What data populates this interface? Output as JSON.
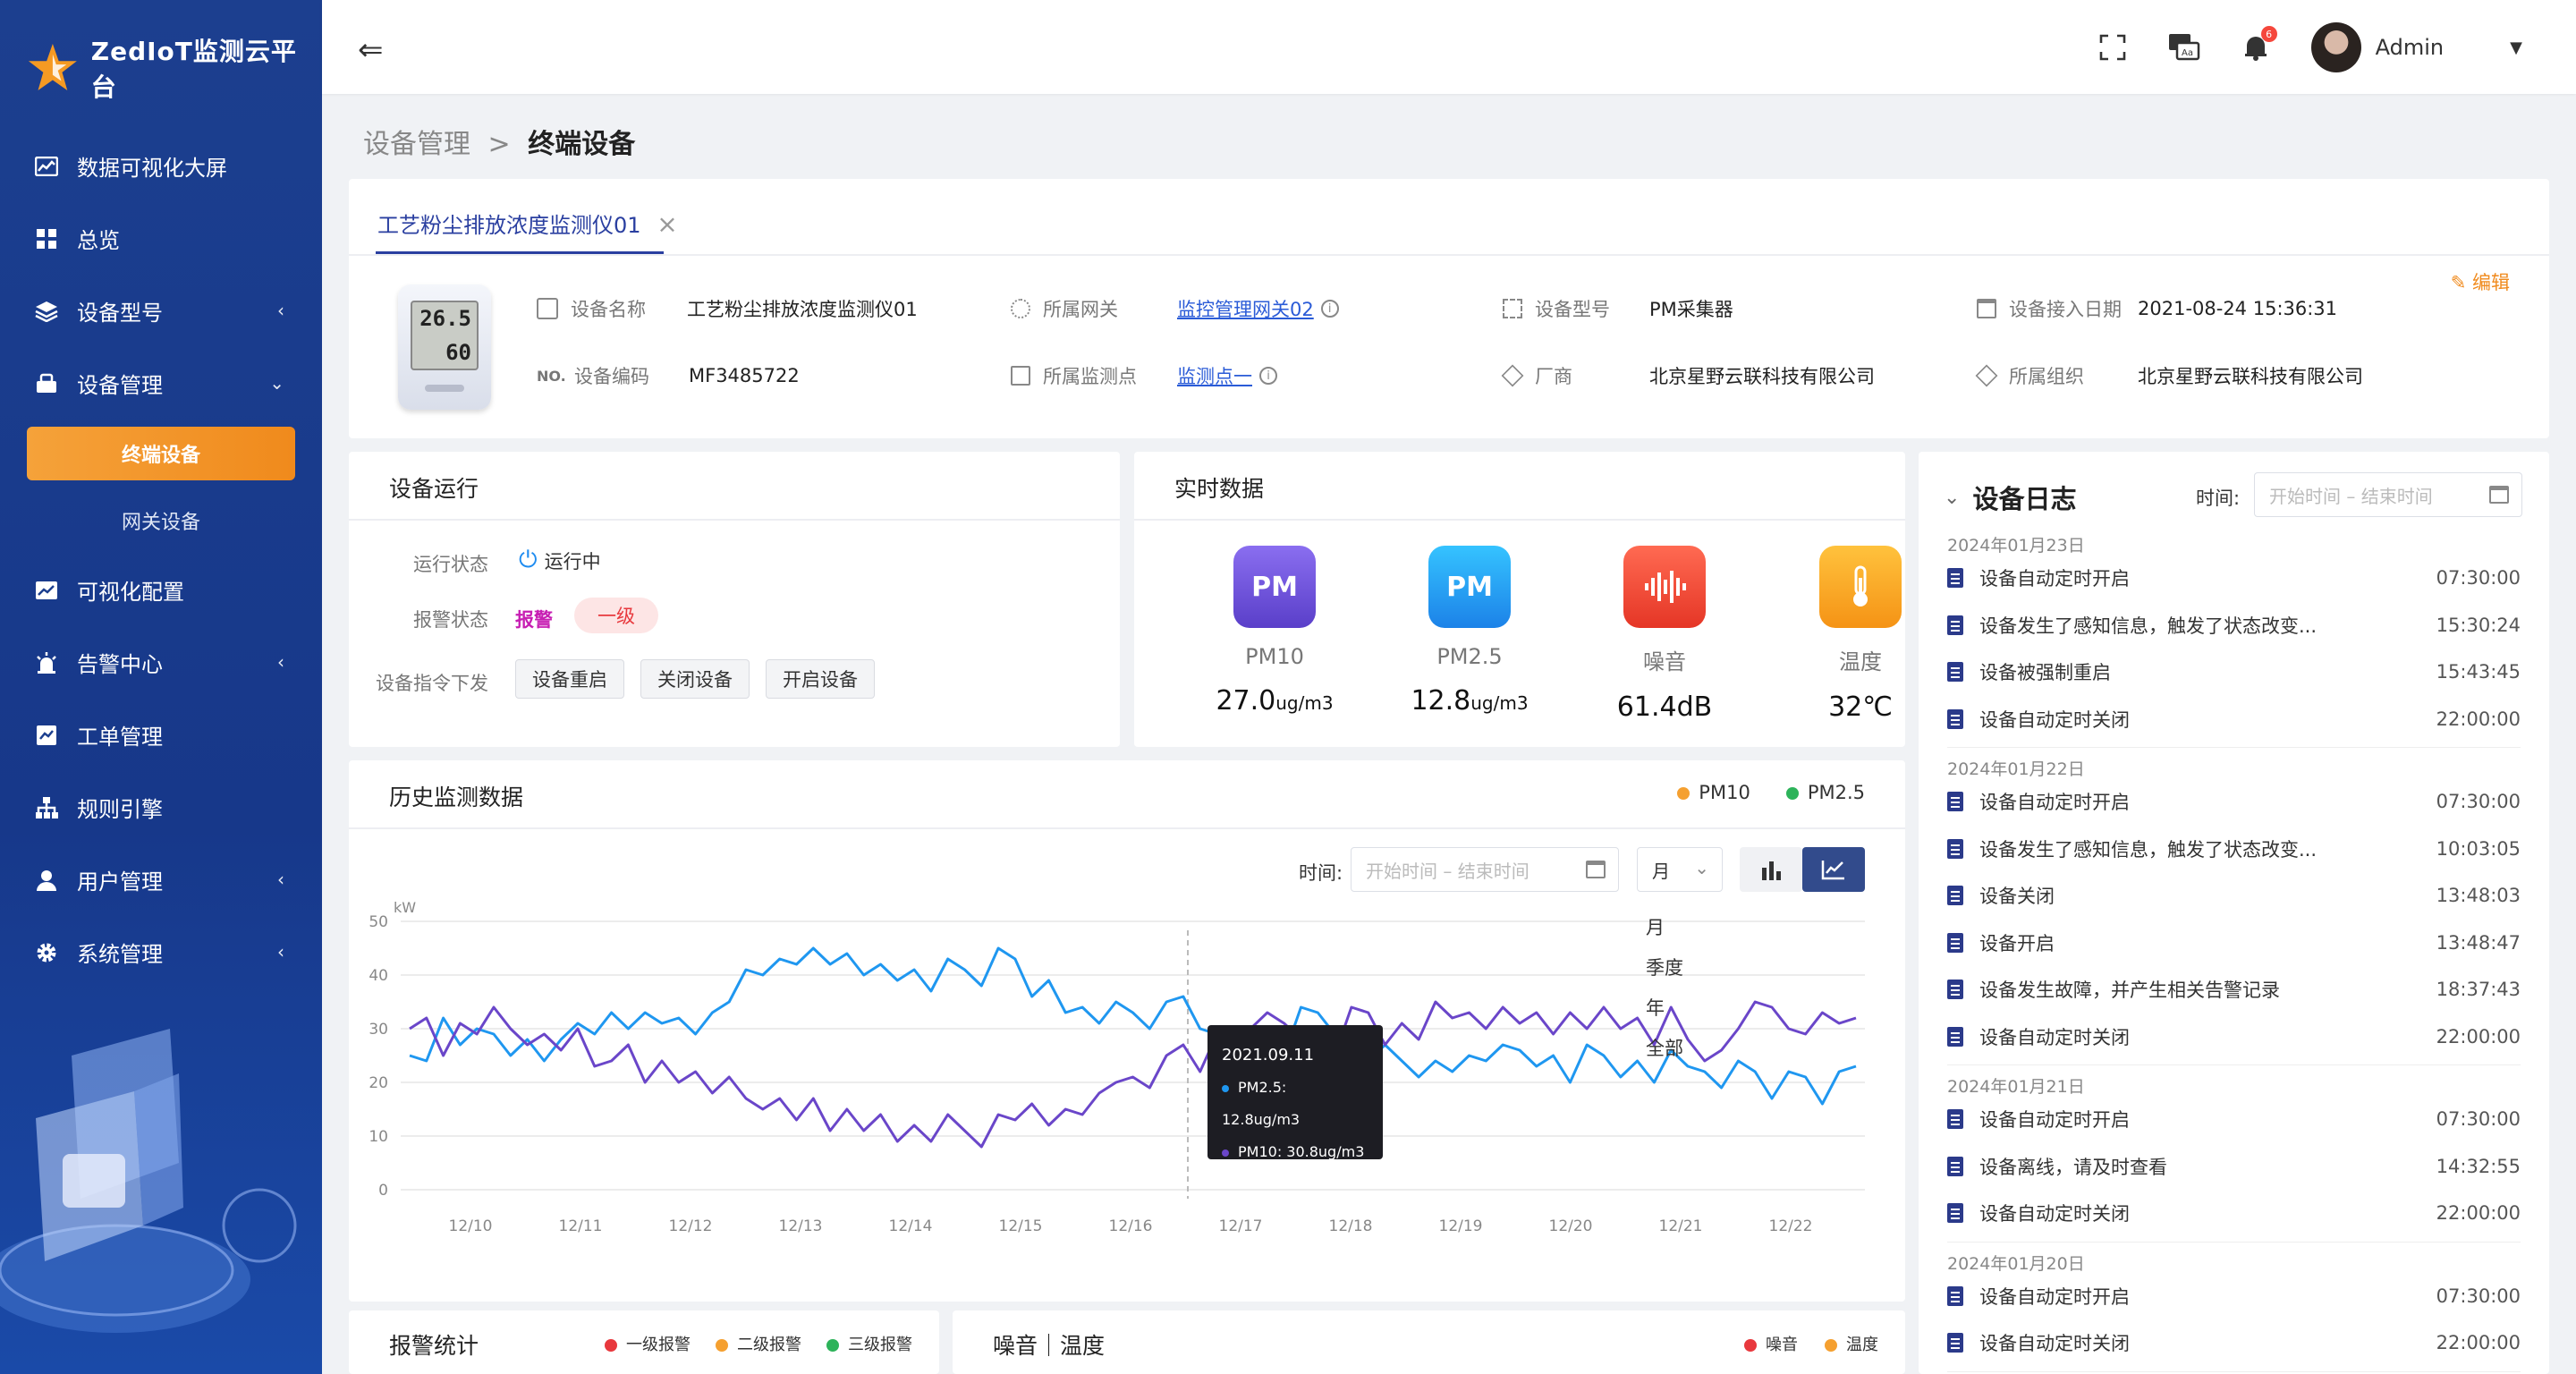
{
  "app": {
    "title": "ZedIoT监测云平台"
  },
  "sidebar": {
    "items": [
      {
        "label": "数据可视化大屏",
        "icon": "chart-area-icon"
      },
      {
        "label": "总览",
        "icon": "grid-icon"
      },
      {
        "label": "设备型号",
        "icon": "layers-icon"
      },
      {
        "label": "设备管理",
        "icon": "device-icon"
      },
      {
        "label": "终端设备",
        "sub": true,
        "active": true
      },
      {
        "label": "网关设备",
        "sub": true
      },
      {
        "label": "可视化配置",
        "icon": "chart-line-icon"
      },
      {
        "label": "告警中心",
        "icon": "alarm-icon"
      },
      {
        "label": "工单管理",
        "icon": "workorder-icon"
      },
      {
        "label": "规则引擎",
        "icon": "rules-icon"
      },
      {
        "label": "用户管理",
        "icon": "user-icon"
      },
      {
        "label": "系统管理",
        "icon": "gear-icon"
      }
    ]
  },
  "topbar": {
    "user": "Admin",
    "notify_count": "6"
  },
  "breadcrumb": {
    "parent": "设备管理",
    "sep": ">",
    "current": "终端设备"
  },
  "tab": {
    "label": "工艺粉尘排放浓度监测仪01",
    "close": "×"
  },
  "device": {
    "edit": "编辑",
    "display_a": "26.5",
    "display_b": "60",
    "name_label": "设备名称",
    "name": "工艺粉尘排放浓度监测仪01",
    "code_prefix": "NO.",
    "code_label": "设备编码",
    "code": "MF3485722",
    "gateway_label": "所属网关",
    "gateway": "监控管理网关02",
    "point_label": "所属监测点",
    "point": "监测点一",
    "model_label": "设备型号",
    "model": "PM采集器",
    "vendor_label": "厂商",
    "vendor": "北京星野云联科技有限公司",
    "date_label": "设备接入日期",
    "date": "2021-08-24 15:36:31",
    "org_label": "所属组织",
    "org": "北京星野云联科技有限公司"
  },
  "run": {
    "title": "设备运行",
    "status_label": "运行状态",
    "status": "运行中",
    "alarm_label": "报警状态",
    "alarm": "报警",
    "alarm_level": "一级",
    "cmd_label": "设备指令下发",
    "buttons": [
      "设备重启",
      "关闭设备",
      "开启设备"
    ]
  },
  "realtime": {
    "title": "实时数据",
    "items": [
      {
        "icon_text": "PM",
        "name": "PM10",
        "value": "27.0",
        "unit": "ug/m3",
        "color": "#6a4fd8"
      },
      {
        "icon_text": "PM",
        "name": "PM2.5",
        "value": "12.8",
        "unit": "ug/m3",
        "color": "#2a9bf0"
      },
      {
        "icon_text": "",
        "name": "噪音",
        "value": "61.4dB",
        "unit": "",
        "color": "#f0493a"
      },
      {
        "icon_text": "",
        "name": "温度",
        "value": "32℃",
        "unit": "",
        "color": "#f5a623"
      }
    ]
  },
  "history": {
    "title": "历史监测数据",
    "legend": [
      {
        "name": "PM10",
        "color": "#f5a030"
      },
      {
        "name": "PM2.5",
        "color": "#2db35a"
      }
    ],
    "time_label": "时间:",
    "date_placeholder": "开始时间 – 结束时间",
    "period": "月",
    "dropdown_options": [
      "月",
      "季度",
      "年",
      "全部"
    ],
    "tooltip": {
      "date": "2021.09.11",
      "pm25": "PM2.5: 12.8ug/m3",
      "pm10": "PM10: 30.8ug/m3"
    }
  },
  "log": {
    "title": "设备日志",
    "time_label": "时间:",
    "date_placeholder": "开始时间 – 结束时间",
    "groups": [
      {
        "date": "2024年01月23日",
        "rows": [
          {
            "text": "设备自动定时开启",
            "time": "07:30:00"
          },
          {
            "text": "设备发生了感知信息，触发了状态改变...",
            "time": "15:30:24"
          },
          {
            "text": "设备被强制重启",
            "time": "15:43:45"
          },
          {
            "text": "设备自动定时关闭",
            "time": "22:00:00"
          }
        ]
      },
      {
        "date": "2024年01月22日",
        "rows": [
          {
            "text": "设备自动定时开启",
            "time": "07:30:00"
          },
          {
            "text": "设备发生了感知信息，触发了状态改变...",
            "time": "10:03:05"
          },
          {
            "text": "设备关闭",
            "time": "13:48:03"
          },
          {
            "text": "设备开启",
            "time": "13:48:47"
          },
          {
            "text": "设备发生故障，并产生相关告警记录",
            "time": "18:37:43"
          },
          {
            "text": "设备自动定时关闭",
            "time": "22:00:00"
          }
        ]
      },
      {
        "date": "2024年01月21日",
        "rows": [
          {
            "text": "设备自动定时开启",
            "time": "07:30:00"
          },
          {
            "text": "设备离线，请及时查看",
            "time": "14:32:55"
          },
          {
            "text": "设备自动定时关闭",
            "time": "22:00:00"
          }
        ]
      },
      {
        "date": "2024年01月20日",
        "rows": [
          {
            "text": "设备自动定时开启",
            "time": "07:30:00"
          },
          {
            "text": "设备自动定时关闭",
            "time": "22:00:00"
          }
        ]
      }
    ]
  },
  "alarm_stats": {
    "title": "报警统计",
    "legend": [
      {
        "name": "一级报警",
        "color": "#e8383d"
      },
      {
        "name": "二级报警",
        "color": "#f5a030"
      },
      {
        "name": "三级报警",
        "color": "#2db35a"
      }
    ]
  },
  "noise_temp": {
    "title": "噪音｜温度",
    "legend": [
      {
        "name": "噪音",
        "color": "#e8383d"
      },
      {
        "name": "温度",
        "color": "#f5a030"
      }
    ]
  },
  "chart_data": {
    "type": "line",
    "ylabel": "kW",
    "ylim": [
      0,
      50
    ],
    "yticks": [
      0,
      10,
      20,
      30,
      40,
      50
    ],
    "xtick_labels": [
      "12/10",
      "12/11",
      "12/12",
      "12/13",
      "12/14",
      "12/15",
      "12/16",
      "12/17",
      "12/18",
      "12/19",
      "12/20",
      "12/21",
      "12/22"
    ],
    "grid": true,
    "series": [
      {
        "name": "PM2.5",
        "color": "#1f97f0",
        "values": [
          25,
          24,
          32,
          27,
          30,
          29,
          25,
          28,
          24,
          28,
          31,
          29,
          33,
          30,
          33,
          31,
          32,
          29,
          33,
          35,
          41,
          40,
          43,
          42,
          45,
          42,
          44,
          40,
          42,
          39,
          41,
          37,
          43,
          41,
          38,
          45,
          43,
          36,
          39,
          33,
          34,
          31,
          35,
          33,
          30,
          35,
          36,
          30,
          29,
          24,
          28,
          26,
          25,
          34,
          33,
          29,
          25,
          24,
          27,
          24,
          21,
          24,
          22,
          25,
          24,
          27,
          26,
          23,
          25,
          20,
          27,
          25,
          21,
          24,
          20,
          26,
          23,
          22,
          19,
          24,
          22,
          17,
          22,
          21,
          16,
          22,
          23
        ]
      },
      {
        "name": "PM10",
        "color": "#6a46c9",
        "values": [
          30,
          32,
          25,
          31,
          29,
          34,
          30,
          27,
          29,
          26,
          30,
          23,
          24,
          27,
          20,
          24,
          20,
          22,
          18,
          21,
          17,
          15,
          17,
          13,
          17,
          11,
          15,
          11,
          14,
          9,
          12,
          9,
          14,
          11,
          8,
          14,
          13,
          16,
          12,
          15,
          14,
          18,
          20,
          21,
          19,
          25,
          27,
          22,
          29,
          28,
          30,
          33,
          31,
          28,
          30,
          25,
          34,
          33,
          27,
          31,
          28,
          35,
          32,
          33,
          30,
          34,
          31,
          33,
          29,
          33,
          30,
          34,
          30,
          32,
          27,
          34,
          28,
          24,
          26,
          30,
          35,
          34,
          30,
          29,
          33,
          31,
          32
        ]
      }
    ]
  }
}
